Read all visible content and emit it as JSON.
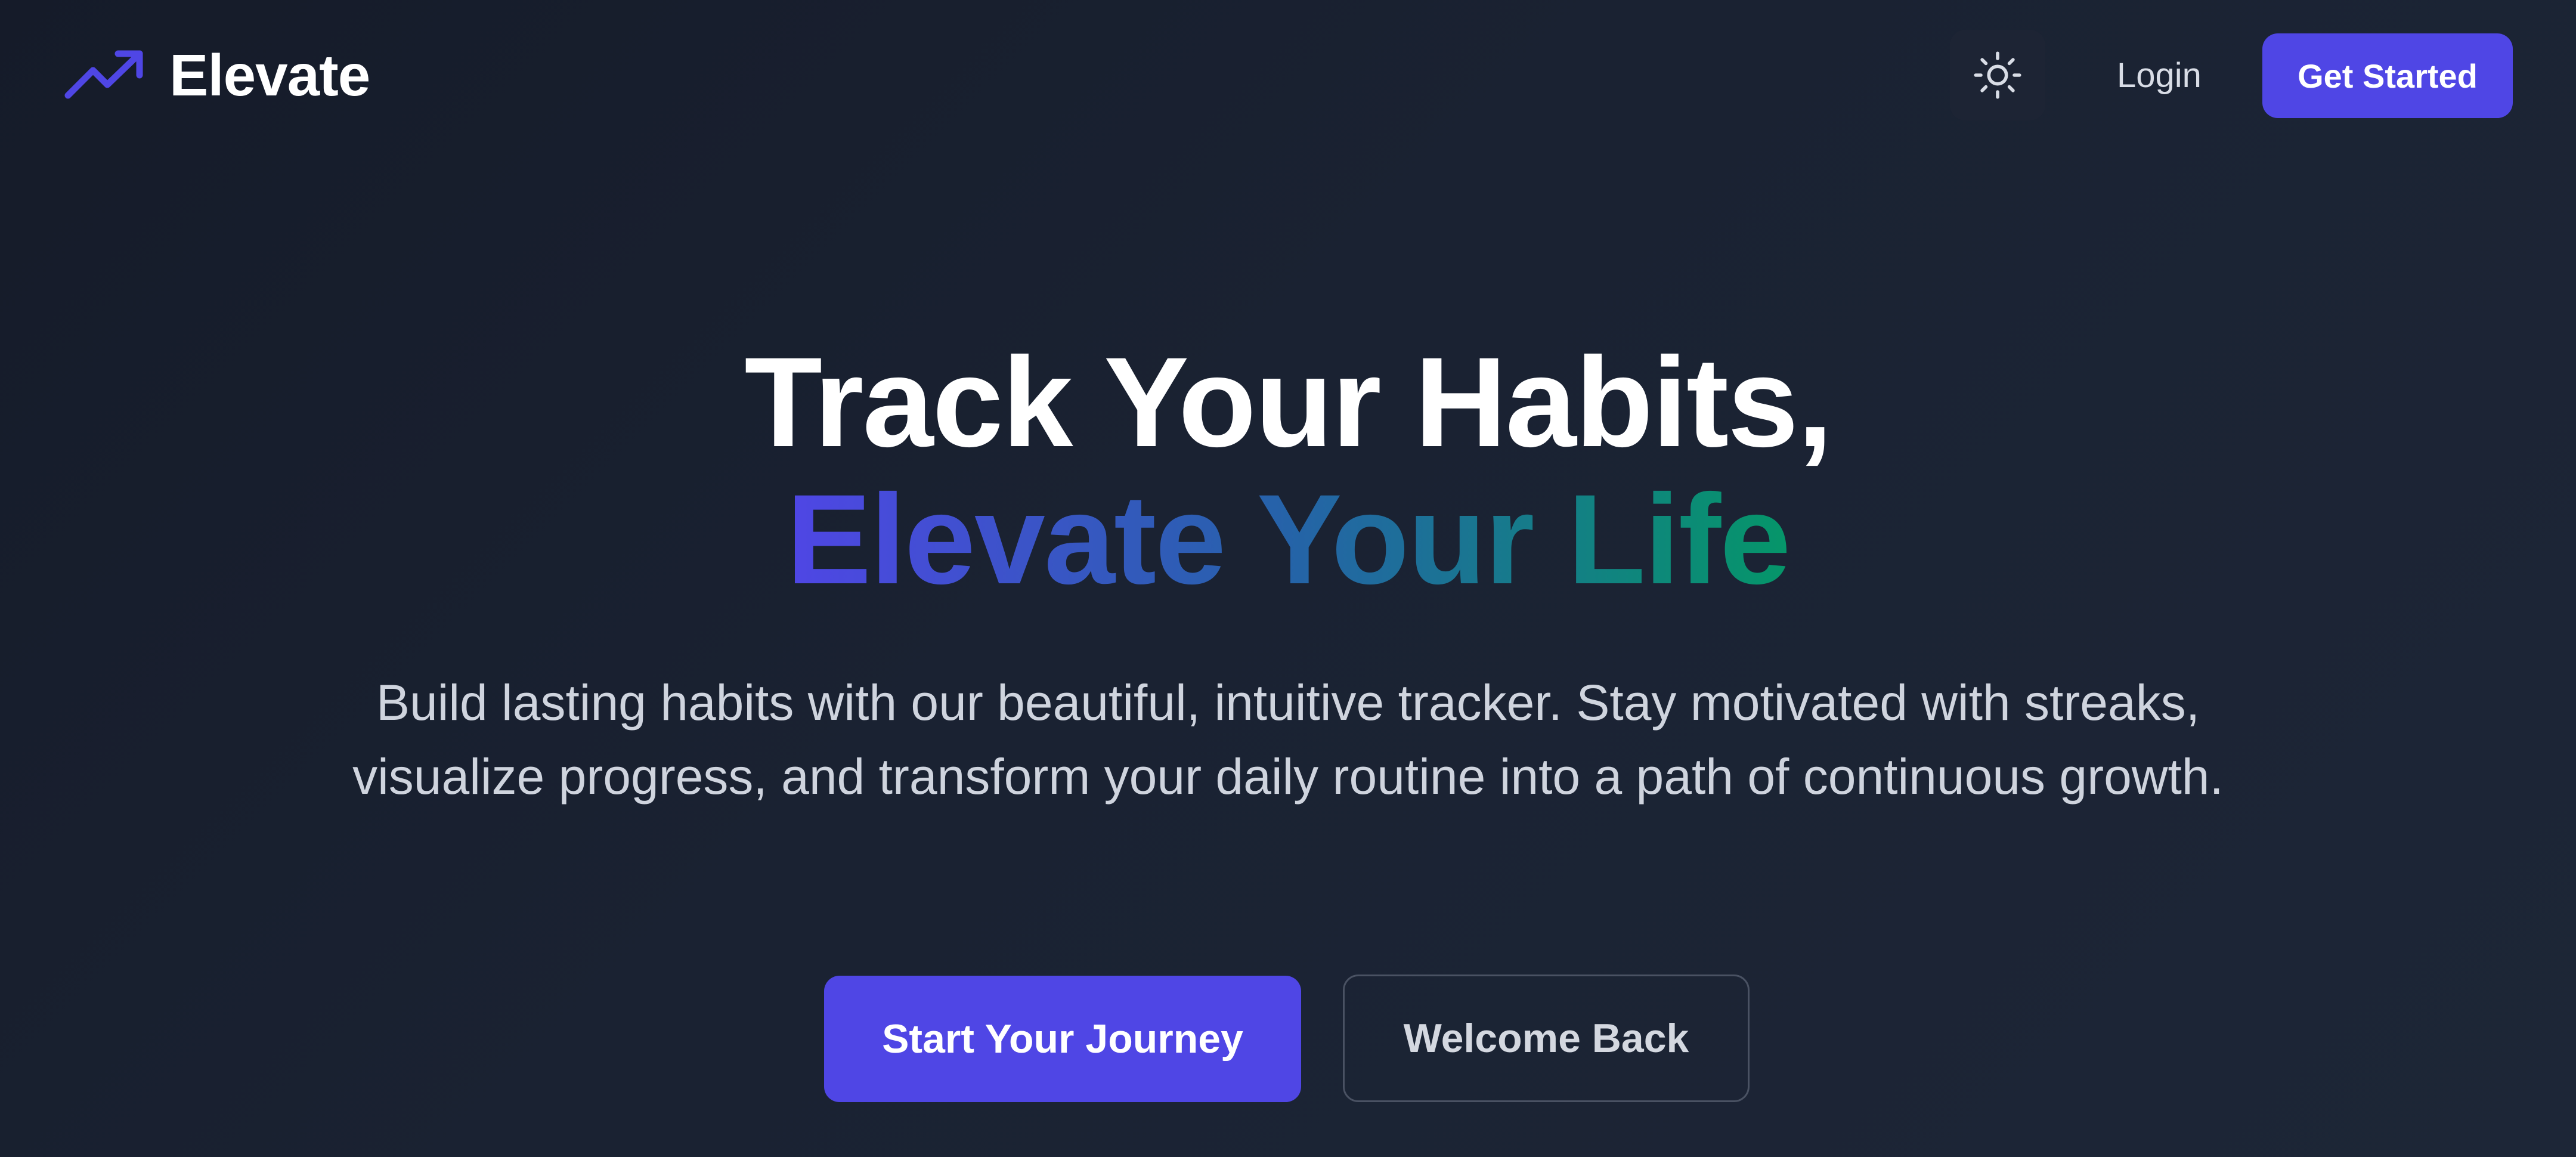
{
  "nav": {
    "brand_name": "Elevate",
    "brand_icon": "trending-up-icon",
    "theme_icon": "sun-icon",
    "login_label": "Login",
    "get_started_label": "Get Started"
  },
  "hero": {
    "title_line1": "Track Your Habits,",
    "title_line2": "Elevate Your Life",
    "subtitle": "Build lasting habits with our beautiful, intuitive tracker. Stay motivated with streaks, visualize progress, and transform your daily routine into a path of continuous growth.",
    "primary_cta": "Start Your Journey",
    "secondary_cta": "Welcome Back"
  },
  "colors": {
    "background": "#1a2232",
    "accent": "#4f46e5",
    "gradient_start": "#4f46e5",
    "gradient_mid": "#2563a8",
    "gradient_end": "#059669",
    "text_primary": "#ffffff",
    "text_secondary": "#cfd4de"
  }
}
